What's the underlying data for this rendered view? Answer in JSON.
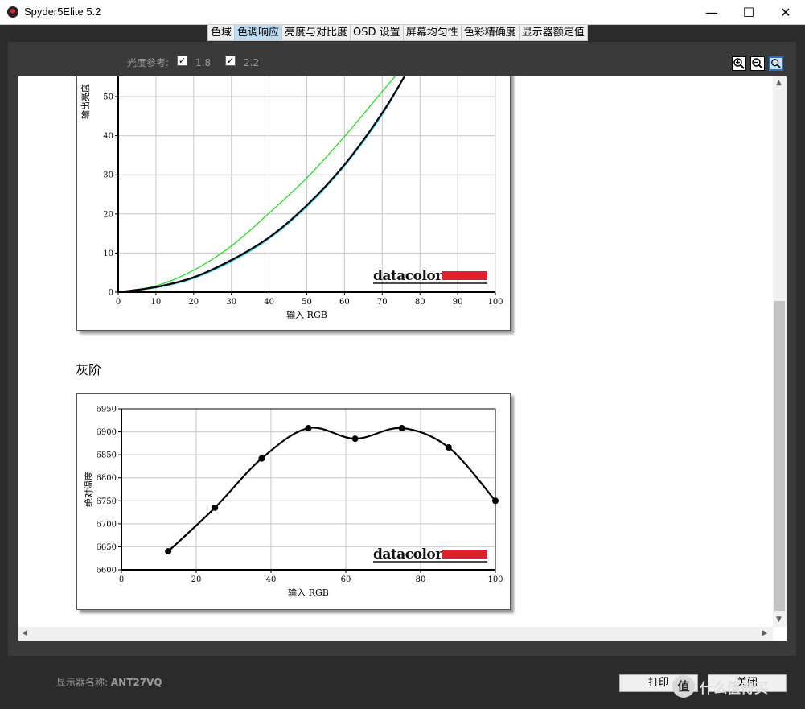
{
  "window": {
    "title": "Spyder5Elite 5.2",
    "minimize": "—",
    "maximize": "☐",
    "close": "✕"
  },
  "tabs": [
    {
      "label": "色域",
      "active": false
    },
    {
      "label": "色调响应",
      "active": true
    },
    {
      "label": "亮度与对比度",
      "active": false
    },
    {
      "label": "OSD 设置",
      "active": false
    },
    {
      "label": "屏幕均匀性",
      "active": false
    },
    {
      "label": "色彩精确度",
      "active": false
    },
    {
      "label": "显示器额定值",
      "active": false
    }
  ],
  "toolbar": {
    "reference_label": "光度参考:",
    "ref1": {
      "label": "1.8",
      "checked": true
    },
    "ref2": {
      "label": "2.2",
      "checked": true
    },
    "zoom_in_icon": "zoom-in-icon",
    "zoom_out_icon": "zoom-out-icon",
    "zoom_fit_icon": "zoom-fit-icon"
  },
  "section_title": "灰阶",
  "logo_text": "datacolor",
  "footer": {
    "display_name_label": "显示器名称:",
    "display_name_value": "ANT27VQ",
    "print_button": "打印",
    "close_button": "关闭",
    "watermark_icon": "值",
    "watermark_text": "什么值得买"
  },
  "chart_data": [
    {
      "type": "line",
      "xlabel": "输入 RGB",
      "ylabel": "输出亮度",
      "xlim": [
        0,
        100
      ],
      "ylim": [
        0,
        57
      ],
      "x_ticks": [
        0,
        10,
        20,
        30,
        40,
        50,
        60,
        70,
        80,
        90,
        100
      ],
      "y_ticks": [
        0,
        10,
        20,
        30,
        40,
        50
      ],
      "grid": true,
      "series": [
        {
          "color": "#22dd22",
          "x": [
            0,
            10,
            20,
            30,
            40,
            50,
            60,
            70,
            75
          ],
          "y": [
            0,
            1.6,
            5.6,
            11.8,
            20.2,
            29.2,
            39.8,
            51.3,
            57
          ]
        },
        {
          "color": "#33ccee",
          "x": [
            0,
            10,
            20,
            30,
            40,
            50,
            60,
            70,
            77
          ],
          "y": [
            0,
            1.1,
            3.5,
            7.8,
            13.6,
            21.8,
            32.2,
            45.3,
            57
          ]
        },
        {
          "color": "#000000",
          "x": [
            0,
            10,
            20,
            30,
            40,
            50,
            60,
            70,
            77
          ],
          "y": [
            0,
            1.3,
            3.8,
            8.2,
            14.0,
            22.2,
            32.6,
            45.8,
            57
          ]
        }
      ]
    },
    {
      "type": "line",
      "xlabel": "输入 RGB",
      "ylabel": "绝对温度",
      "xlim": [
        0,
        100
      ],
      "ylim": [
        6600,
        6950
      ],
      "x_ticks": [
        0,
        20,
        40,
        60,
        80,
        100
      ],
      "y_ticks": [
        6600,
        6650,
        6700,
        6750,
        6800,
        6850,
        6900,
        6950
      ],
      "grid": true,
      "series": [
        {
          "color": "#000000",
          "x": [
            12.5,
            25,
            37.5,
            50,
            62.5,
            75,
            87.5,
            100
          ],
          "y": [
            6640,
            6735,
            6842,
            6908,
            6885,
            6908,
            6866,
            6750
          ]
        }
      ]
    }
  ]
}
